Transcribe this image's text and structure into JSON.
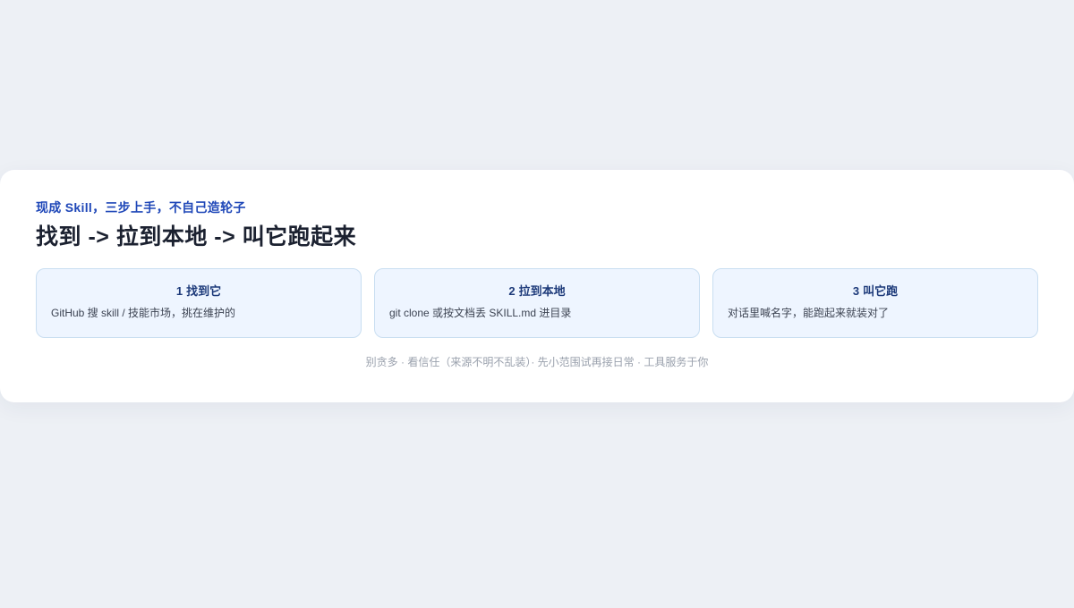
{
  "card": {
    "eyebrow": "现成 Skill，三步上手，不自己造轮子",
    "title": "找到 -> 拉到本地 -> 叫它跑起来",
    "steps": [
      {
        "number": "1",
        "title": "找到它",
        "description": "GitHub 搜 skill / 技能市场，挑在维护的"
      },
      {
        "number": "2",
        "title": "拉到本地",
        "description": "git clone 或按文档丢 SKILL.md 进目录"
      },
      {
        "number": "3",
        "title": "叫它跑",
        "description": "对话里喊名字，能跑起来就装对了"
      }
    ],
    "footer": "别贪多 · 看信任（来源不明不乱装）· 先小范围试再接日常 · 工具服务于你"
  },
  "colors": {
    "page_background": "#edf0f5",
    "card_background": "#ffffff",
    "accent": "#1f47b8",
    "step_background": "#eef5ff",
    "step_border": "#c9def1"
  }
}
